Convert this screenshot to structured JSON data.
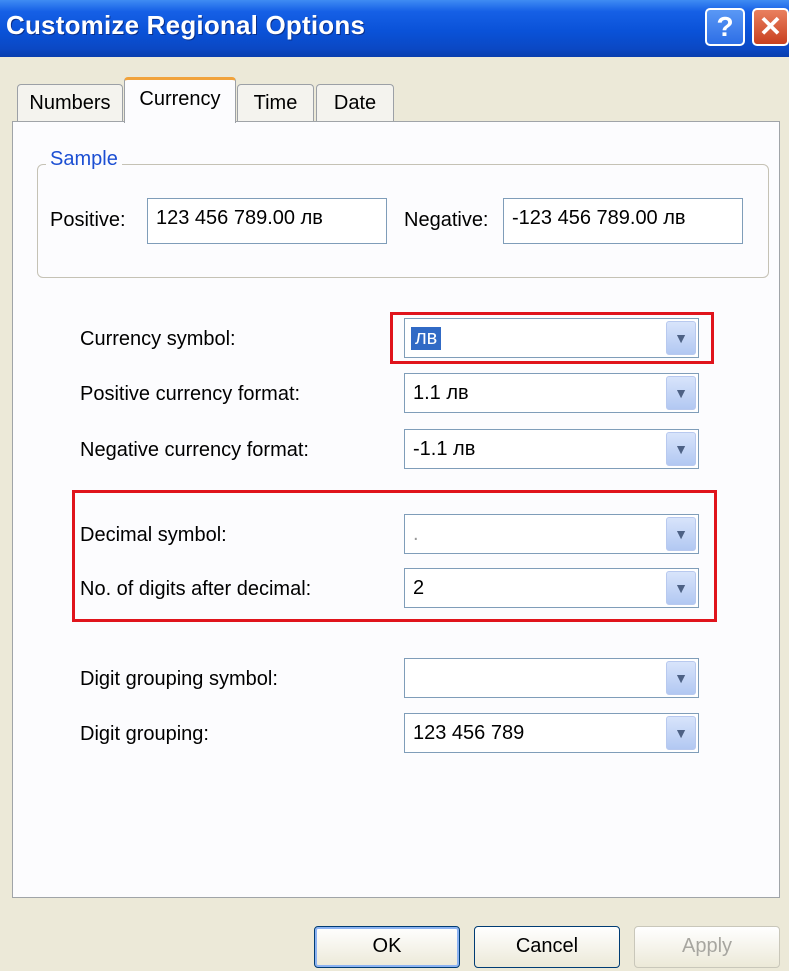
{
  "window": {
    "title": "Customize Regional Options",
    "help_glyph": "?",
    "close_glyph": "✕"
  },
  "tabs": [
    {
      "label": "Numbers",
      "active": false
    },
    {
      "label": "Currency",
      "active": true
    },
    {
      "label": "Time",
      "active": false
    },
    {
      "label": "Date",
      "active": false
    }
  ],
  "sample": {
    "title": "Sample",
    "positive_label": "Positive:",
    "positive_value": "123 456 789.00 лв",
    "negative_label": "Negative:",
    "negative_value": "-123 456 789.00 лв"
  },
  "fields": {
    "currency_symbol": {
      "label": "Currency symbol:",
      "value": "лв",
      "selected": true
    },
    "positive_format": {
      "label": "Positive currency format:",
      "value": "1.1 лв"
    },
    "negative_format": {
      "label": "Negative currency format:",
      "value": "-1.1 лв"
    },
    "decimal_symbol": {
      "label": "Decimal symbol:",
      "value": "."
    },
    "digits_after_decimal": {
      "label": "No. of digits after decimal:",
      "value": "2"
    },
    "grouping_symbol": {
      "label": "Digit grouping symbol:",
      "value": ""
    },
    "digit_grouping": {
      "label": "Digit grouping:",
      "value": "123 456 789"
    }
  },
  "buttons": {
    "ok": "OK",
    "cancel": "Cancel",
    "apply": "Apply"
  },
  "icons": {
    "dropdown": "chevron-down-icon",
    "help": "help-icon",
    "close": "close-icon"
  },
  "colors": {
    "title_bar": "#0a52d8",
    "highlight": "#e0141c",
    "selection": "#316ac5"
  }
}
